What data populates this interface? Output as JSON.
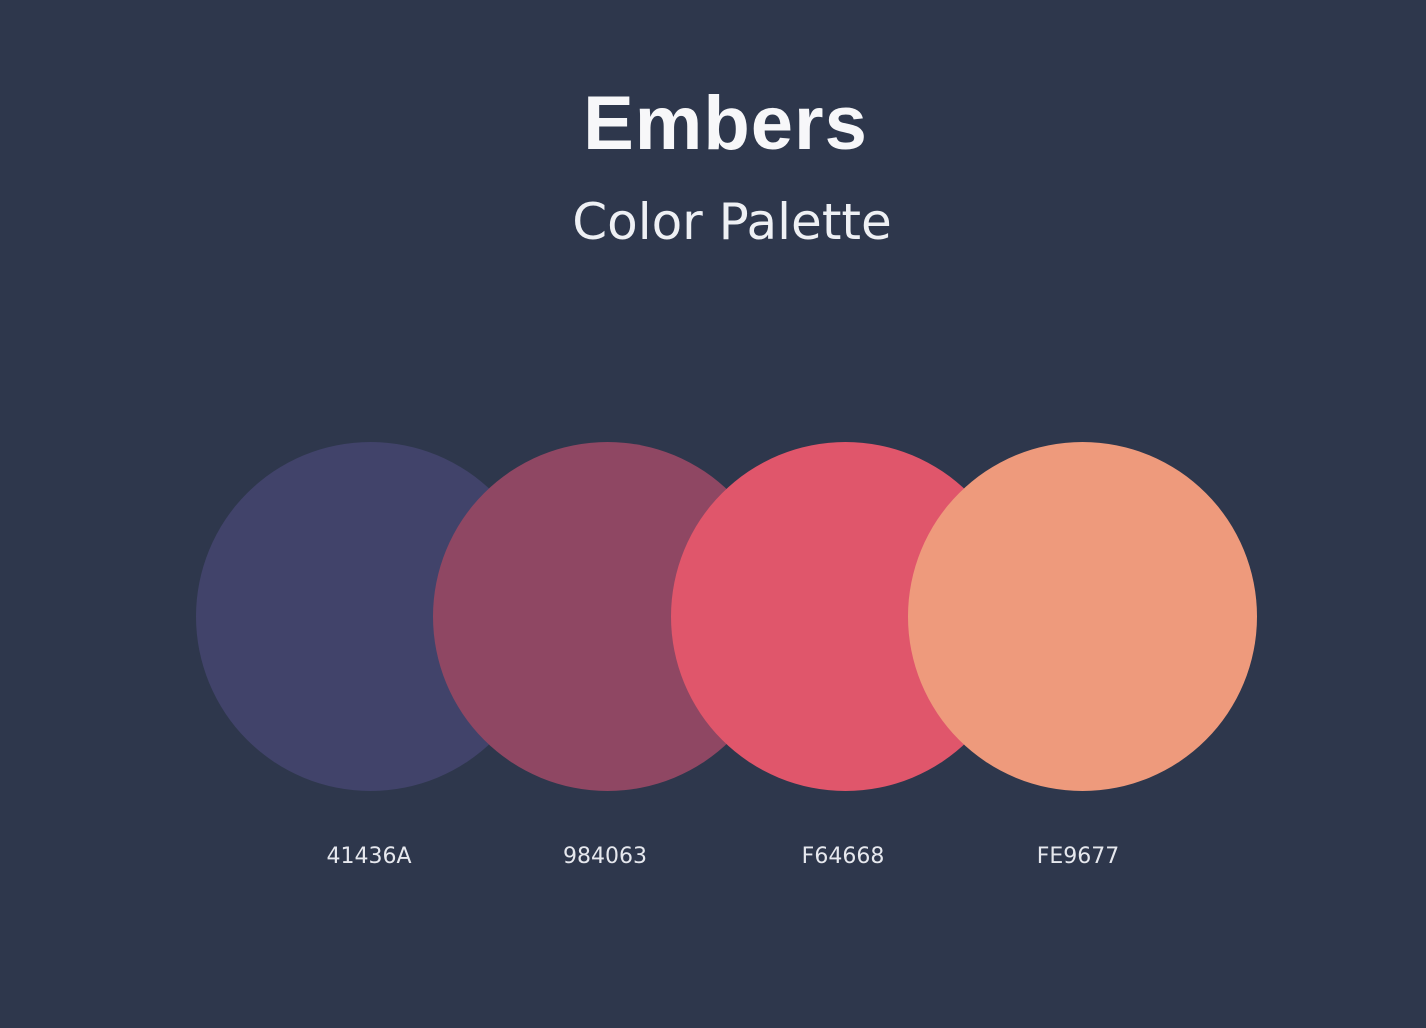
{
  "title": "Embers",
  "subtitle": "Color Palette",
  "colors": {
    "background": "#2e374c",
    "title_text": "#f7f7f9",
    "label_text": "#e6e8ee"
  },
  "swatches": [
    {
      "code": "41436A",
      "fill": "#41436A"
    },
    {
      "code": "984063",
      "fill": "#8f4763"
    },
    {
      "code": "F64668",
      "fill": "#e0566b"
    },
    {
      "code": "FE9677",
      "fill": "#ee9a7c"
    }
  ]
}
